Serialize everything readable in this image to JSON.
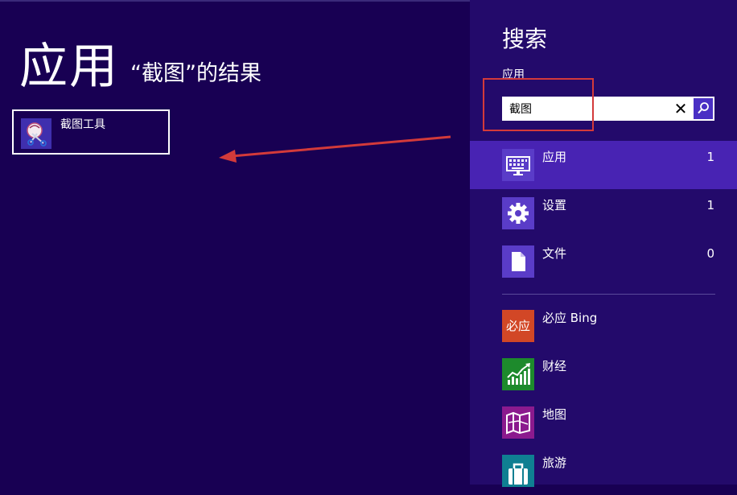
{
  "results_panel": {
    "title": "应用",
    "subtitle": "“截图”的结果",
    "results": [
      {
        "label": "截图工具",
        "icon": "snipping-tool-icon"
      }
    ]
  },
  "search_charm": {
    "title": "搜索",
    "scope_label": "应用",
    "query": "截图",
    "clear_icon": "✕",
    "scopes": [
      {
        "label": "应用",
        "count": "1",
        "icon": "keyboard-monitor-icon",
        "selected": true
      },
      {
        "label": "设置",
        "count": "1",
        "icon": "gear-icon",
        "selected": false
      },
      {
        "label": "文件",
        "count": "0",
        "icon": "document-icon",
        "selected": false
      }
    ],
    "apps": [
      {
        "label": "必应 Bing",
        "tile_text": "必应",
        "color": "#d24726",
        "icon": "bing-tile-icon"
      },
      {
        "label": "财经",
        "color": "#1d8a2c",
        "icon": "finance-chart-icon"
      },
      {
        "label": "地图",
        "color": "#8b1a8e",
        "icon": "map-icon"
      },
      {
        "label": "旅游",
        "color": "#0f7f92",
        "icon": "suitcase-icon"
      }
    ]
  },
  "colors": {
    "background": "#180053",
    "charm_background": "#230a6b",
    "selected_row": "#4823b3",
    "annotation_red": "#d33a3a"
  }
}
